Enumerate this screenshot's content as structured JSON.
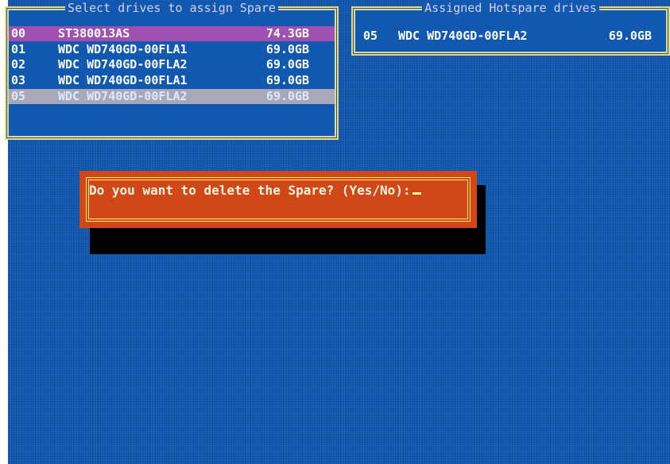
{
  "select_panel": {
    "title": "Select drives to assign Spare",
    "drives": [
      {
        "num": "00",
        "model": "ST380013AS",
        "size": "74.3GB",
        "state": "highlight"
      },
      {
        "num": "01",
        "model": "WDC WD740GD-00FLA1",
        "size": "69.0GB",
        "state": "normal"
      },
      {
        "num": "02",
        "model": "WDC WD740GD-00FLA2",
        "size": "69.0GB",
        "state": "normal"
      },
      {
        "num": "03",
        "model": "WDC WD740GD-00FLA1",
        "size": "69.0GB",
        "state": "normal"
      },
      {
        "num": "05",
        "model": "WDC WD740GD-00FLA2",
        "size": "69.0GB",
        "state": "selected"
      }
    ]
  },
  "assigned_panel": {
    "title": "Assigned Hotspare drives",
    "drives": [
      {
        "num": "05",
        "model": "WDC WD740GD-00FLA2",
        "size": "69.0GB"
      }
    ]
  },
  "dialog": {
    "prompt": "Do you want to delete the Spare? (Yes/No):"
  },
  "colors": {
    "screen_bg": "#1058b0",
    "panel_border": "#e8d880",
    "highlight_row": "#a050b0",
    "selected_row": "#a8a8b8",
    "dialog_bg": "#d04818",
    "dialog_border": "#f4e870"
  }
}
